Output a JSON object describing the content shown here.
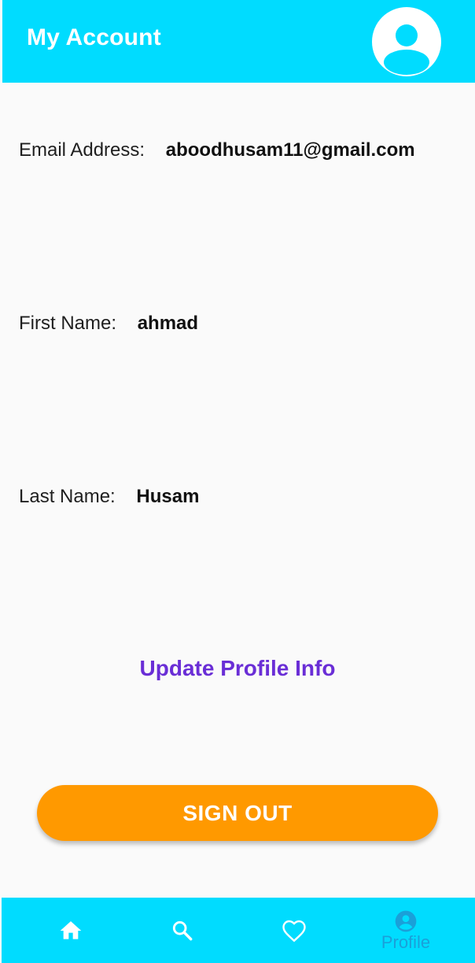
{
  "appbar": {
    "title": "My Account",
    "avatar_icon": "account-circle-icon"
  },
  "profile": {
    "email_label": "Email Address:",
    "email_value": "aboodhusam11@gmail.com",
    "first_name_label": "First Name:",
    "first_name_value": "ahmad",
    "last_name_label": "Last Name:",
    "last_name_value": "Husam"
  },
  "actions": {
    "update_label": "Update Profile Info",
    "signout_label": "SIGN OUT"
  },
  "bottom_nav": {
    "items": [
      {
        "icon": "home-icon",
        "label": ""
      },
      {
        "icon": "search-icon",
        "label": ""
      },
      {
        "icon": "heart-icon",
        "label": ""
      },
      {
        "icon": "account-circle-icon",
        "label": "Profile",
        "active": true
      }
    ]
  },
  "colors": {
    "primary": "#00dcff",
    "accent": "#ff9900",
    "link": "#6a2ed6",
    "active_nav": "#1aa0d9"
  }
}
